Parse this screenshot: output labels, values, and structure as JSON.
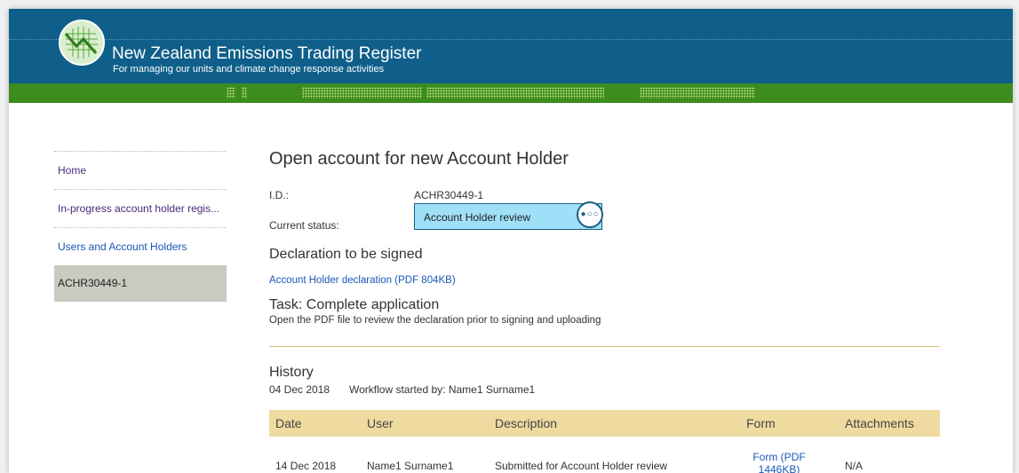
{
  "header": {
    "title": "New Zealand Emissions Trading Register",
    "subtitle": "For managing our units and climate change response activities",
    "colors": {
      "header_bg": "#0f5f8a",
      "green_band": "#3d8c1f"
    }
  },
  "sidebar": {
    "items": [
      {
        "label": "Home"
      },
      {
        "label": "In-progress account holder regis..."
      },
      {
        "label": "Users and Account Holders"
      },
      {
        "label": "ACHR30449-1"
      }
    ]
  },
  "main": {
    "title": "Open account for new Account Holder",
    "id_label": "I.D.:",
    "id_value": "ACHR30449-1",
    "status_label": "Current status:",
    "status_value": "Account Holder review",
    "status_icon": "more-dots-icon",
    "declaration_heading": "Declaration to be signed",
    "declaration_link": "Account Holder declaration (PDF 804KB)",
    "task_heading": "Task: Complete application",
    "task_description": "Open the PDF file to review the declaration prior to signing and uploading",
    "history_heading": "History",
    "history_date": "04 Dec 2018",
    "history_text": "Workflow started by: Name1 Surname1",
    "table": {
      "headers": [
        "Date",
        "User",
        "Description",
        "Form",
        "Attachments"
      ],
      "rows": [
        {
          "date": "14 Dec 2018",
          "user": "Name1 Surname1",
          "description": "Submitted for Account Holder review",
          "form": "Form (PDF 1446KB)",
          "attachments": "N/A"
        }
      ]
    }
  }
}
